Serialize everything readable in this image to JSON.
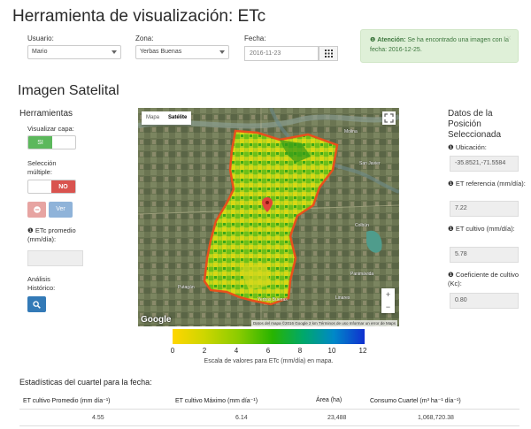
{
  "page_title": "Herramienta de visualización: ETc",
  "filters": {
    "usuario_label": "Usuario:",
    "usuario_value": "Mario",
    "zona_label": "Zona:",
    "zona_value": "Yerbas Buenas",
    "fecha_label": "Fecha:",
    "fecha_value": "2016-11-23"
  },
  "alert": {
    "strong": "Atención:",
    "text": "Se ha encontrado una imagen con la fecha: 2016-12-25.",
    "close": "×"
  },
  "section_title": "Imagen Satelital",
  "tools": {
    "title": "Herramientas",
    "visualizar_label": "Visualizar capa:",
    "visualizar_on": "SI",
    "seleccion_label": "Selección múltiple:",
    "seleccion_off": "NO",
    "ver_label": "Ver",
    "etc_promedio_label": "ETc promedio (mm/día):",
    "etc_promedio_value": "",
    "analisis_label": "Análisis Histórico:"
  },
  "map": {
    "tab_map": "Mapa",
    "tab_satellite": "Satélite",
    "zoom_in": "+",
    "zoom_out": "−",
    "logo": "Google",
    "attribution": "Datos del mapa ©2016 Google   2 km   Términos de uso   Informar un error de Maps",
    "towns": [
      "Molina",
      "Putagán",
      "Yerbas Buenas",
      "Linares",
      "Colbún",
      "Panimávida",
      "San Javier"
    ]
  },
  "legend": {
    "ticks": [
      "0",
      "2",
      "4",
      "6",
      "8",
      "10",
      "12"
    ],
    "caption": "Escala de valores para ETc (mm/día) en mapa."
  },
  "selected": {
    "title": "Datos de la Posición Seleccionada",
    "ubicacion_label": "Ubicación:",
    "ubicacion_value": "-35.8521,-71.5584",
    "et_ref_label": "ET referencia (mm/día):",
    "et_ref_value": "7.22",
    "et_cult_label": "ET cultivo (mm/día):",
    "et_cult_value": "5.78",
    "kc_label": "Coeficiente de cultivo (Kc):",
    "kc_value": "0.80"
  },
  "stats": {
    "title": "Estadísticas del cuartel para la fecha:",
    "headers": [
      "ET cultivo Promedio (mm día⁻¹)",
      "ET cultivo Máximo (mm día⁻¹)",
      "Área (ha)",
      "Consumo Cuartel (m³ ha⁻¹ día⁻¹)"
    ],
    "values": [
      "4.55",
      "6.14",
      "23,488",
      "1,068,720.38"
    ]
  },
  "colors": {
    "success": "#5cb85c",
    "danger": "#d9534f",
    "primary": "#337ab7",
    "alert_bg": "#dff0d8"
  }
}
